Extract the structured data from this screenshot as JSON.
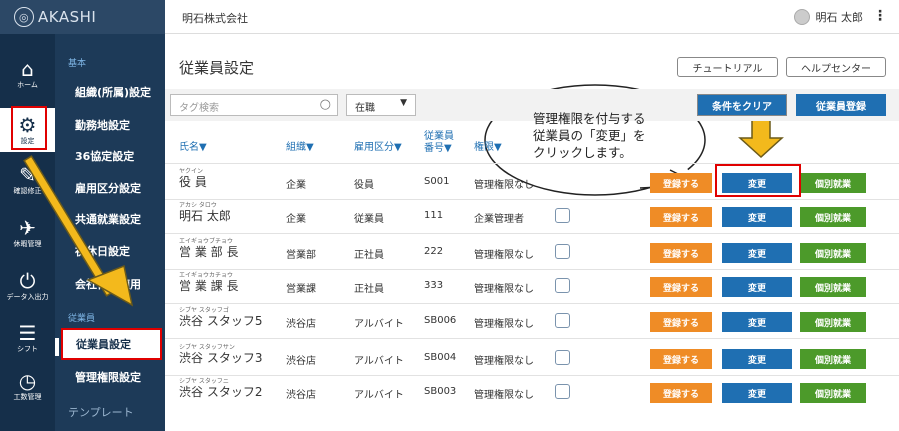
{
  "app": {
    "brand": "AKASHI"
  },
  "rail": [
    {
      "label": "ホーム",
      "icon": "⌂"
    },
    {
      "label": "設定",
      "icon": "⚙"
    },
    {
      "label": "確認修正",
      "icon": "✎"
    },
    {
      "label": "休暇管理",
      "icon": "✈"
    },
    {
      "label": "データ入出力",
      "icon": "⏻"
    },
    {
      "label": "シフト",
      "icon": "☰"
    },
    {
      "label": "工数管理",
      "icon": "◷"
    }
  ],
  "submenu": {
    "section_basic": "基本",
    "items": [
      "組織(所属)設定",
      "勤務地設定",
      "36協定設定",
      "雇用区分設定",
      "共通就業設定",
      "祝休日設定",
      "会社休日適用"
    ],
    "section_employee": "従業員",
    "employee_items": [
      "従業員設定",
      "管理権限設定"
    ],
    "section_template": "テンプレート"
  },
  "header": {
    "company": "明石株式会社",
    "user": "明石 太郎",
    "menu": "⋮"
  },
  "page": {
    "title": "従業員設定",
    "tutorial": "チュートリアル",
    "help": "ヘルプセンター",
    "tag_placeholder": "タグ検索",
    "status_value": "在職",
    "clear_button": "条件をクリア",
    "register_button": "従業員登録"
  },
  "table": {
    "headers": {
      "name": "氏名▼",
      "org": "組織▼",
      "employment": "雇用区分▼",
      "number": "従業員番号▼",
      "number_line1": "従業員",
      "number_line2": "番号▼",
      "auth": "権限▼"
    },
    "rows": [
      {
        "kana": "ヤクイン",
        "name": "役 員",
        "org": "企業",
        "type": "役員",
        "no": "S001",
        "auth": "管理権限なし"
      },
      {
        "kana": "アカシ タロウ",
        "name": "明石 太郎",
        "org": "企業",
        "type": "従業員",
        "no": "111",
        "auth": "企業管理者"
      },
      {
        "kana": "エイギョウブチョウ",
        "name": "営 業 部 長",
        "org": "営業部",
        "type": "正社員",
        "no": "222",
        "auth": "管理権限なし"
      },
      {
        "kana": "エイギョウカチョウ",
        "name": "営 業 課 長",
        "org": "営業課",
        "type": "正社員",
        "no": "333",
        "auth": "管理権限なし"
      },
      {
        "kana": "シブヤ スタッフゴ",
        "name": "渋谷 スタッフ5",
        "org": "渋谷店",
        "type": "アルバイト",
        "no": "SB006",
        "auth": "管理権限なし"
      },
      {
        "kana": "シブヤ スタッフサン",
        "name": "渋谷 スタッフ3",
        "org": "渋谷店",
        "type": "アルバイト",
        "no": "SB004",
        "auth": "管理権限なし"
      },
      {
        "kana": "シブヤ スタッフニ",
        "name": "渋谷 スタッフ2",
        "org": "渋谷店",
        "type": "アルバイト",
        "no": "SB003",
        "auth": "管理権限なし"
      }
    ],
    "btn_register": "登録する",
    "btn_change": "変更",
    "btn_individual": "個別就業"
  },
  "annotation": {
    "callout_line1": "管理権限を付与する",
    "callout_line2": "従業員の「変更」を",
    "callout_line3": "クリックします。"
  },
  "colors": {
    "accent_blue": "#1f6fb2",
    "orange": "#ef8c26",
    "green": "#4c9a2a",
    "highlight_red": "#e00000",
    "arrow_yellow": "#f3b91c"
  }
}
